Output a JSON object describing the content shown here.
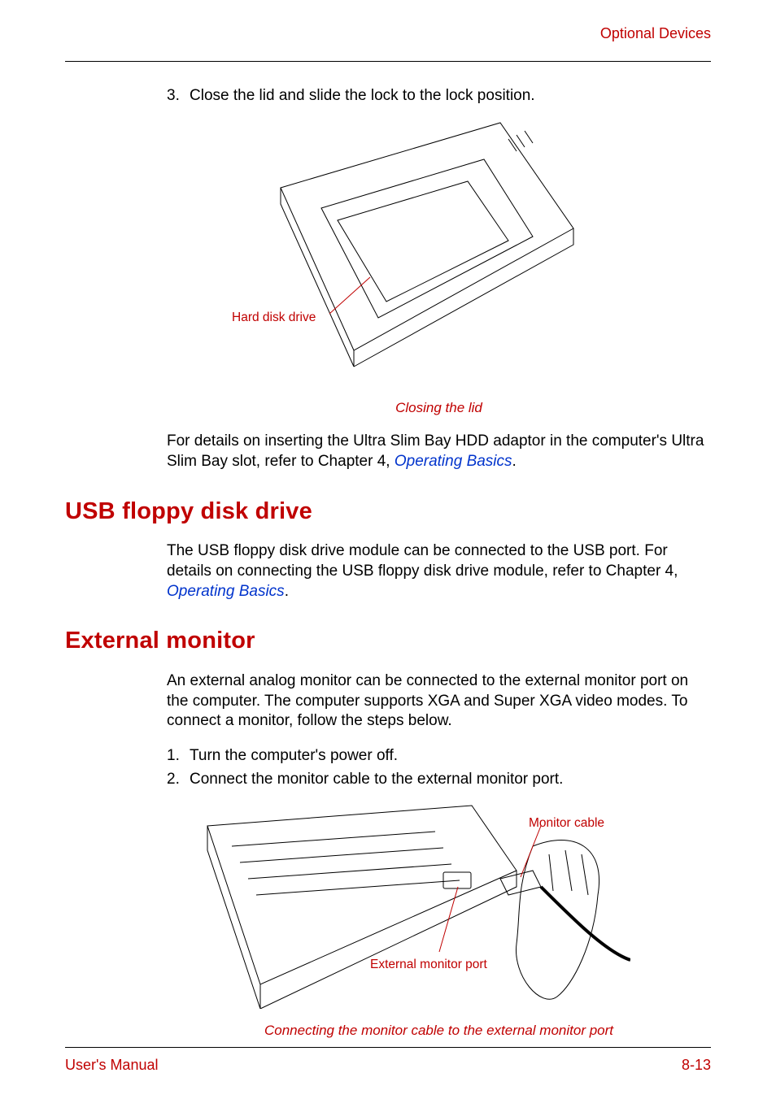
{
  "header": {
    "section": "Optional Devices"
  },
  "steps_top": {
    "num": "3.",
    "text": "Close the lid and slide the lock to the lock position."
  },
  "fig1": {
    "label_hdd": "Hard disk drive",
    "caption": "Closing the lid"
  },
  "para_ultraslim_prefix": "For details on inserting the Ultra Slim Bay HDD adaptor in the computer's Ultra Slim Bay slot, refer to Chapter 4, ",
  "para_ultraslim_link": "Operating Basics",
  "para_ultraslim_suffix": ".",
  "section_usb": {
    "title": "USB floppy disk drive",
    "para_prefix": "The USB floppy disk drive module can be connected to the USB port. For details on connecting the USB floppy disk drive module, refer to Chapter 4, ",
    "para_link": "Operating Basics",
    "para_suffix": "."
  },
  "section_ext": {
    "title": "External monitor",
    "para": "An external analog monitor can be connected to the external monitor port on the computer. The computer supports XGA and Super XGA video modes. To connect a monitor, follow the steps below.",
    "step1_num": "1.",
    "step1_text": "Turn the computer's power off.",
    "step2_num": "2.",
    "step2_text": "Connect the monitor cable to the external monitor port."
  },
  "fig2": {
    "label_cable": "Monitor cable",
    "label_port": "External monitor port",
    "caption": "Connecting the monitor cable to the external monitor port"
  },
  "footer": {
    "left": "User's Manual",
    "right": "8-13"
  }
}
